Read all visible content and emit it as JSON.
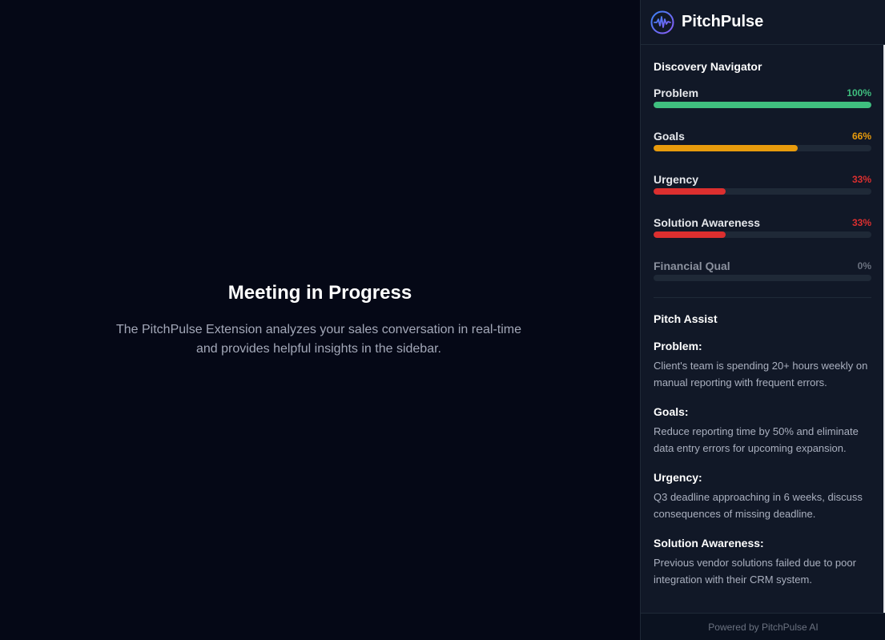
{
  "main": {
    "title": "Meeting in Progress",
    "description": "The PitchPulse Extension analyzes your sales conversation in real-time and provides helpful insights in the sidebar."
  },
  "sidebar": {
    "brand": "PitchPulse",
    "logo_icon": "pulse-waveform-icon",
    "navigator": {
      "title": "Discovery Navigator",
      "metrics": [
        {
          "label": "Problem",
          "percent_text": "100%",
          "value": 100,
          "color": "#3fbf7f",
          "label_color": "#e5e7eb"
        },
        {
          "label": "Goals",
          "percent_text": "66%",
          "value": 66,
          "color": "#e89b0c",
          "label_color": "#e5e7eb"
        },
        {
          "label": "Urgency",
          "percent_text": "33%",
          "value": 33,
          "color": "#dc2f2f",
          "label_color": "#e5e7eb"
        },
        {
          "label": "Solution Awareness",
          "percent_text": "33%",
          "value": 33,
          "color": "#dc2f2f",
          "label_color": "#e5e7eb"
        },
        {
          "label": "Financial Qual",
          "percent_text": "0%",
          "value": 0,
          "color": "#6b7280",
          "label_color": "#8b919e"
        }
      ]
    },
    "assist": {
      "title": "Pitch Assist",
      "items": [
        {
          "heading": "Problem:",
          "text": "Client's team is spending 20+ hours weekly on manual reporting with frequent errors."
        },
        {
          "heading": "Goals:",
          "text": "Reduce reporting time by 50% and eliminate data entry errors for upcoming expansion."
        },
        {
          "heading": "Urgency:",
          "text": "Q3 deadline approaching in 6 weeks, discuss consequences of missing deadline."
        },
        {
          "heading": "Solution Awareness:",
          "text": "Previous vendor solutions failed due to poor integration with their CRM system."
        }
      ]
    },
    "footer": "Powered by PitchPulse AI"
  }
}
